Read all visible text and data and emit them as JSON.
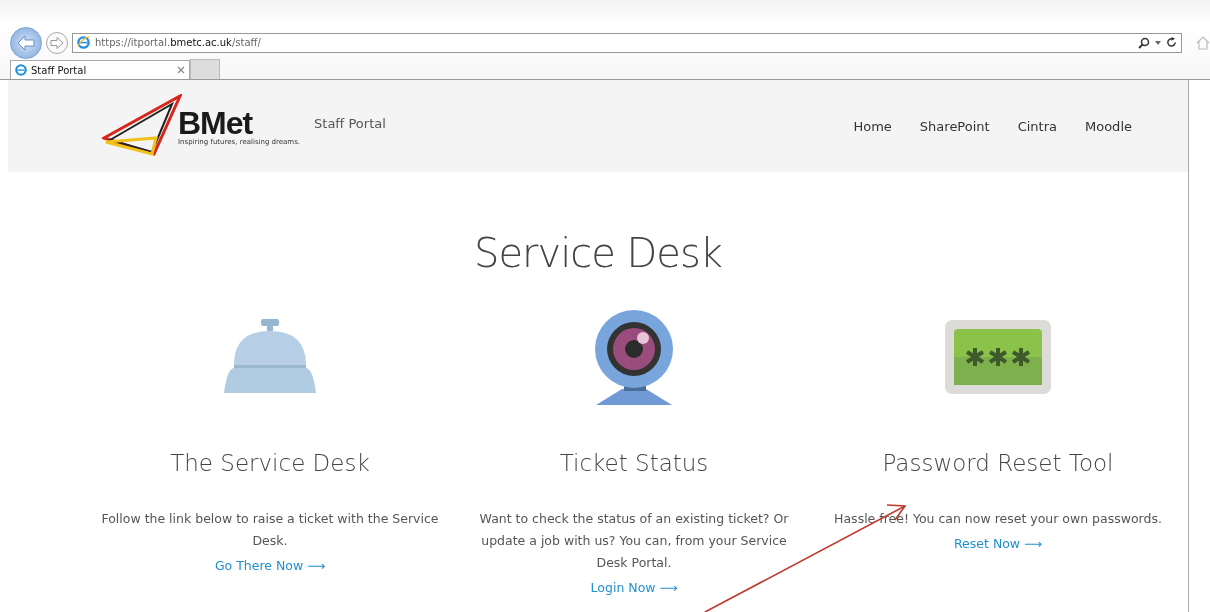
{
  "browser": {
    "url": "https://itportal.**bmetc.ac.uk**/staff/",
    "tab": {
      "title": "Staff Portal",
      "selected": true
    }
  },
  "header": {
    "brand": "BMet",
    "tagline": "Inspiring futures, realising dreams.",
    "site_name": "Staff Portal",
    "nav": [
      "Home",
      "SharePoint",
      "Cintra",
      "Moodle"
    ]
  },
  "title": "Service Desk",
  "cards": [
    {
      "kind": "bell",
      "heading": "The Service Desk",
      "text": "Follow the link below to raise a ticket with the Service Desk.",
      "link": "Go There Now ⟶"
    },
    {
      "kind": "webcam",
      "heading": "Ticket Status",
      "text": "Want to check the status of an existing ticket? Or update a job with us? You can, from your Service Desk Portal.",
      "link": "Login Now ⟶"
    },
    {
      "kind": "password",
      "heading": "Password Reset Tool",
      "text": "Hassle free! You can now reset your own passwords.",
      "link": "Reset Now ⟶"
    }
  ],
  "annotation": {
    "kind": "arrow"
  }
}
